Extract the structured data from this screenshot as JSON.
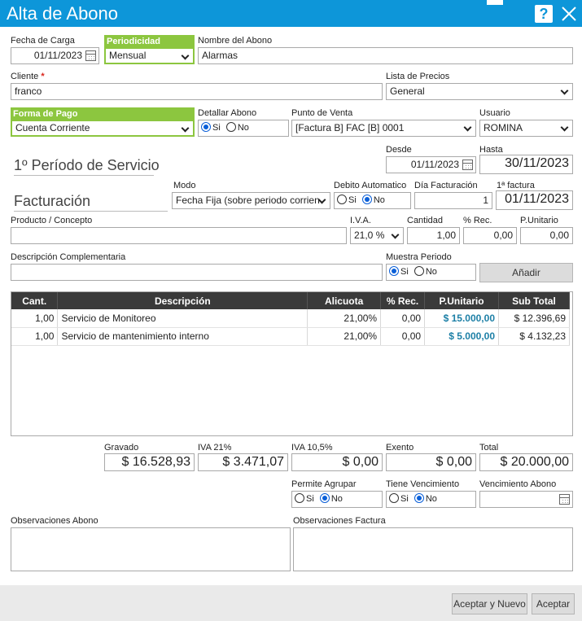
{
  "window": {
    "title": "Alta de Abono"
  },
  "fecha_carga": {
    "label": "Fecha de Carga",
    "value": "01/11/2023"
  },
  "periodicidad": {
    "label": "Periodicidad",
    "value": "Mensual"
  },
  "nombre_abono": {
    "label": "Nombre del Abono",
    "value": "Alarmas"
  },
  "cliente": {
    "label": "Cliente",
    "required_mark": "*",
    "value": "franco"
  },
  "lista_precios": {
    "label": "Lista de Precios",
    "value": "General"
  },
  "forma_pago": {
    "label": "Forma de Pago",
    "value": "Cuenta Corriente"
  },
  "detallar_abono": {
    "label": "Detallar Abono",
    "si": "Si",
    "no": "No",
    "selected": "Si"
  },
  "punto_venta": {
    "label": "Punto de Venta",
    "value": "[Factura B] FAC [B] 0001"
  },
  "usuario": {
    "label": "Usuario",
    "value": "ROMINA"
  },
  "periodo": {
    "section_title": "1º Período de Servicio",
    "desde_label": "Desde",
    "desde_value": "01/11/2023",
    "hasta_label": "Hasta",
    "hasta_value": "30/11/2023"
  },
  "facturacion": {
    "section_title": "Facturación",
    "modo_label": "Modo",
    "modo_value": "Fecha Fija (sobre periodo corrien",
    "debito_label": "Debito Automatico",
    "si": "Si",
    "no": "No",
    "debito_selected": "No",
    "dia_label": "Día Facturación",
    "dia_value": "1",
    "primera_label": "1ª factura",
    "primera_value": "01/11/2023"
  },
  "producto": {
    "producto_label": "Producto / Concepto",
    "producto_value": "",
    "iva_label": "I.V.A.",
    "iva_value": "21,0 %",
    "cantidad_label": "Cantidad",
    "cantidad_value": "1,00",
    "rec_label": "% Rec.",
    "rec_value": "0,00",
    "punitario_label": "P.Unitario",
    "punitario_value": "0,00",
    "desc_comp_label": "Descripción Complementaria",
    "desc_comp_value": "",
    "muestra_label": "Muestra Periodo",
    "si": "Si",
    "no": "No",
    "muestra_selected": "Si",
    "add_button": "Añadir"
  },
  "items": {
    "headers": [
      "Cant.",
      "Descripción",
      "Alicuota",
      "% Rec.",
      "P.Unitario",
      "Sub Total"
    ],
    "rows": [
      {
        "cant": "1,00",
        "desc": "Servicio de Monitoreo",
        "alicuota": "21,00%",
        "rec": "0,00",
        "punitario": "$ 15.000,00",
        "subtotal": "$ 12.396,69"
      },
      {
        "cant": "1,00",
        "desc": "Servicio de mantenimiento interno",
        "alicuota": "21,00%",
        "rec": "0,00",
        "punitario": "$ 5.000,00",
        "subtotal": "$ 4.132,23"
      }
    ]
  },
  "totals": {
    "gravado_label": "Gravado",
    "gravado": "$ 16.528,93",
    "iva21_label": "IVA 21%",
    "iva21": "$ 3.471,07",
    "iva105_label": "IVA 10,5%",
    "iva105": "$ 0,00",
    "exento_label": "Exento",
    "exento": "$ 0,00",
    "total_label": "Total",
    "total": "$ 20.000,00"
  },
  "opciones": {
    "agrupar_label": "Permite Agrupar",
    "agrupar_selected": "No",
    "vencimiento_label": "Tiene Vencimiento",
    "vencimiento_selected": "No",
    "venc_abono_label": "Vencimiento Abono",
    "venc_abono_value": "",
    "si": "Si",
    "no": "No"
  },
  "observaciones": {
    "abono_label": "Observaciones Abono",
    "factura_label": "Observaciones Factura"
  },
  "footer": {
    "accept_new": "Aceptar y Nuevo",
    "accept": "Aceptar"
  },
  "colors": {
    "titlebar": "#0d96d9",
    "highlight": "#8cc63f",
    "grid_header": "#3a3a3a",
    "price": "#1c7fa6"
  }
}
